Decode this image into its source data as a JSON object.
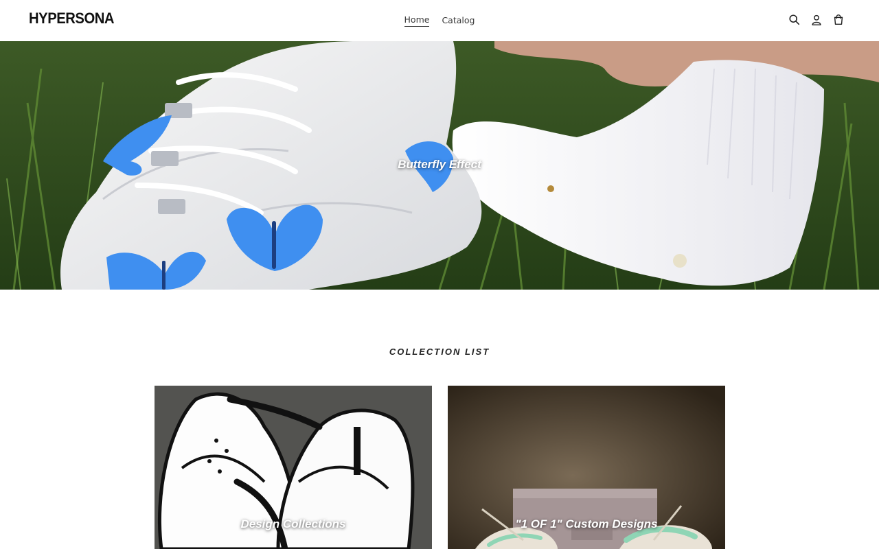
{
  "header": {
    "logo": "HYPERSONA",
    "nav": [
      {
        "label": "Home",
        "active": true
      },
      {
        "label": "Catalog",
        "active": false
      }
    ],
    "icons": [
      "search-icon",
      "account-icon",
      "cart-icon"
    ]
  },
  "hero": {
    "title": "Butterfly Effect"
  },
  "collection_list": {
    "title": "COLLECTION LIST",
    "items": [
      {
        "label": "Design Collections"
      },
      {
        "label": "\"1 OF 1\" Custom Designs"
      }
    ]
  },
  "colors": {
    "text": "#3a3a3a",
    "logo": "#111111",
    "grass": "#2f4a1e",
    "butterfly": "#3f8ff0"
  }
}
